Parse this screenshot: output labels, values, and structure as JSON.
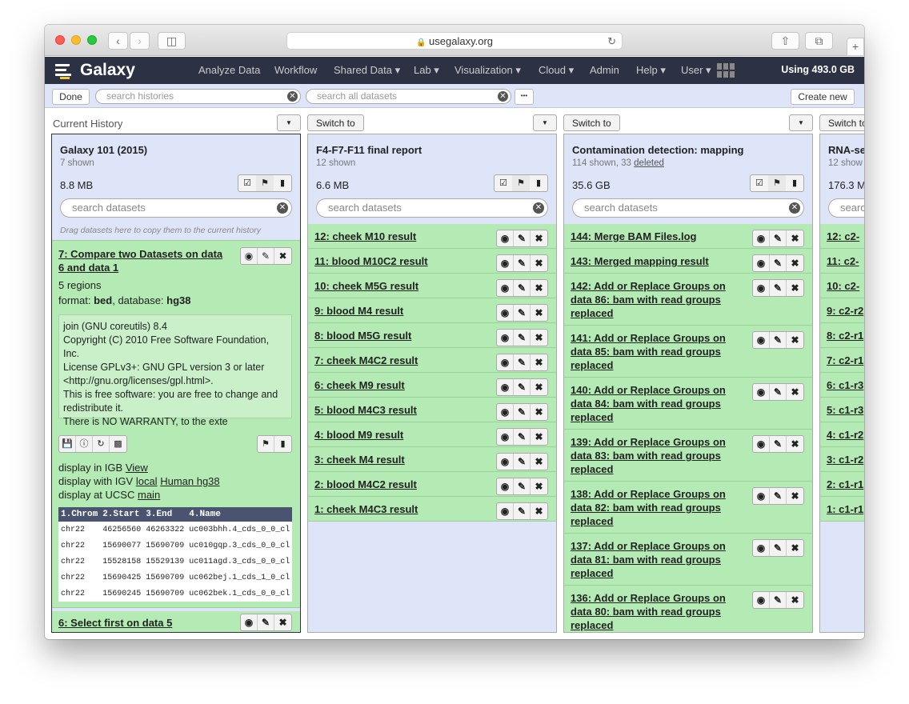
{
  "browser": {
    "url": "usegalaxy.org",
    "new_tab": "+"
  },
  "nav": {
    "brand": "Galaxy",
    "items": [
      "Analyze Data",
      "Workflow",
      "Shared Data ▾",
      "Lab ▾",
      "Visualization ▾",
      "Cloud ▾",
      "Admin",
      "Help ▾",
      "User ▾"
    ],
    "usage": "Using 493.0 GB"
  },
  "toolbar": {
    "done_label": "Done",
    "search_histories_placeholder": "search histories",
    "search_datasets_placeholder": "search all datasets",
    "more_label": "•••",
    "create_new_label": "Create new"
  },
  "labels": {
    "current_history": "Current History",
    "switch_to": "Switch to",
    "search_datasets": "search datasets",
    "drag_hint": "Drag datasets here to copy them to the current history"
  },
  "histories": [
    {
      "title": "Galaxy 101 (2015)",
      "shown": "7 shown",
      "size": "8.8 MB",
      "expanded_dataset": {
        "title": "7: Compare two Datasets on data 6 and data 1",
        "regions": "5 regions",
        "format_label": "format:",
        "format": "bed",
        "database_label": ", database:",
        "database": "hg38",
        "info_lines": [
          "join (GNU coreutils) 8.4",
          "Copyright (C) 2010 Free Software Foundation, Inc.",
          "License GPLv3+: GNU GPL version 3 or later <http://gnu.org/licenses/gpl.html>.",
          "This is free software: you are free to change and redistribute it.",
          "There is NO WARRANTY, to the exte"
        ],
        "display_igb": "display in IGB",
        "igb_view": "View",
        "display_igv": "display with IGV",
        "igv_local": "local",
        "igv_human": "Human hg38",
        "display_ucsc": "display at UCSC",
        "ucsc_main": "main",
        "peek_headers": [
          "1.Chrom",
          "2.Start",
          "3.End",
          "4.Name"
        ],
        "peek_rows": [
          [
            "chr22",
            "46256560",
            "46263322",
            "uc003bhh.4_cds_0_0_cl"
          ],
          [
            "chr22",
            "15690077",
            "15690709",
            "uc010gqp.3_cds_0_0_cl"
          ],
          [
            "chr22",
            "15528158",
            "15529139",
            "uc011agd.3_cds_0_0_cl"
          ],
          [
            "chr22",
            "15690425",
            "15690709",
            "uc062bej.1_cds_1_0_cl"
          ],
          [
            "chr22",
            "15690245",
            "15690709",
            "uc062bek.1_cds_0_0_cl"
          ]
        ]
      },
      "last_dataset": "6: Select first on data 5"
    },
    {
      "title": "F4-F7-F11 final report",
      "shown": "12 shown",
      "size": "6.6 MB",
      "datasets": [
        "12: cheek M10 result",
        "11: blood M10C2 result",
        "10: cheek M5G result",
        "9: blood M4 result",
        "8: blood M5G result",
        "7: cheek M4C2 result",
        "6: cheek M9 result",
        "5: blood M4C3 result",
        "4: blood M9 result",
        "3: cheek M4 result",
        "2: blood M4C2 result",
        "1: cheek M4C3 result"
      ]
    },
    {
      "title": "Contamination detection: mapping",
      "shown": "114 shown, 33",
      "deleted": "deleted",
      "size": "35.6 GB",
      "datasets": [
        "144:  Merge BAM Files.log",
        "143: Merged mapping result",
        "142: Add or Replace Groups on data 86: bam with read groups replaced",
        "141: Add or Replace Groups on data 85: bam with read groups replaced",
        "140: Add or Replace Groups on data 84: bam with read groups replaced",
        "139: Add or Replace Groups on data 83: bam with read groups replaced",
        "138: Add or Replace Groups on data 82: bam with read groups replaced",
        "137: Add or Replace Groups on data 81: bam with read groups replaced",
        "136: Add or Replace Groups on data 80: bam with read groups replaced"
      ]
    },
    {
      "title": "RNA-se",
      "shown": "12 show",
      "size": "176.3 M",
      "search_partial": "searc",
      "datasets": [
        "12: c2-",
        "11: c2-",
        "10: c2-",
        "9: c2-r2",
        "8: c2-r1",
        "7: c2-r1",
        "6: c1-r3",
        "5: c1-r3",
        "4: c1-r2",
        "3: c1-r2",
        "2: c1-r1",
        "1: c1-r1"
      ]
    }
  ],
  "icons": {
    "eye": "👁",
    "pencil": "✎",
    "delete": "✖",
    "check": "☑",
    "tag": "🏷",
    "comment": "💬"
  },
  "colors": {
    "ok_dataset": "#b4eab4",
    "history_bg": "#dfe5f9",
    "masthead": "#2c3143"
  }
}
